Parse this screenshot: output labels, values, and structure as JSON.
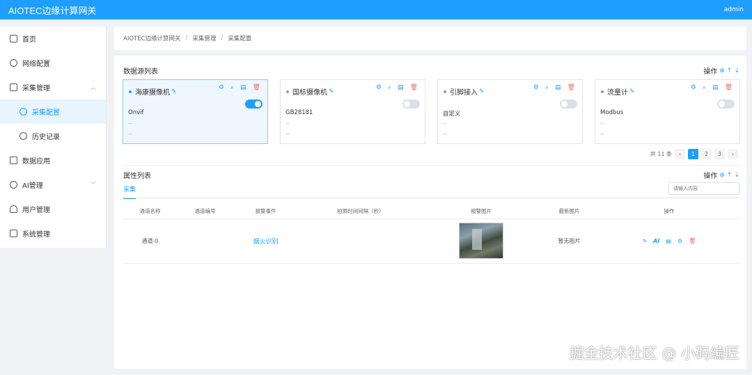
{
  "header": {
    "title": "AIOTEC边缘计算网关",
    "user": "admin"
  },
  "sidebar": {
    "items": [
      {
        "label": "首页",
        "icon": "home-icon"
      },
      {
        "label": "网络配置",
        "icon": "globe-icon"
      },
      {
        "label": "采集管理",
        "icon": "monitor-icon"
      },
      {
        "label": "采集配置",
        "icon": "gear-icon"
      },
      {
        "label": "历史记录",
        "icon": "history-icon"
      },
      {
        "label": "数据应用",
        "icon": "data-icon"
      },
      {
        "label": "AI管理",
        "icon": "ai-icon"
      },
      {
        "label": "用户管理",
        "icon": "user-icon"
      },
      {
        "label": "系统管理",
        "icon": "system-icon"
      }
    ]
  },
  "breadcrumb": [
    "AIOTEC边缘计算网关",
    "采集管理",
    "采集配置"
  ],
  "datasource": {
    "title": "数据源列表",
    "ops_label": "操作",
    "cards": [
      {
        "name": "海康摄像机",
        "protocol": "Onvif",
        "line1": "--",
        "line2": "--",
        "enabled": true
      },
      {
        "name": "国标摄像机",
        "protocol": "GB28181",
        "line1": "--",
        "line2": "--",
        "enabled": false
      },
      {
        "name": "引脚接入",
        "protocol": "自定义",
        "line1": "--",
        "line2": "--",
        "enabled": false
      },
      {
        "name": "流量计",
        "protocol": "Modbus",
        "line1": "--",
        "line2": "--",
        "enabled": false
      }
    ],
    "pager": {
      "total": "共 11 条",
      "prev": "‹",
      "pages": [
        "1",
        "2",
        "3"
      ],
      "next": "›",
      "current": 1
    }
  },
  "attributes": {
    "title": "属性列表",
    "ops_label": "操作",
    "tab": "采集",
    "search_placeholder": "请输入内容",
    "columns": [
      "通道名称",
      "通道编号",
      "报警事件",
      "拍照时间间隔（秒）",
      "报警图片",
      "最新图片",
      "操作"
    ],
    "rows": [
      {
        "name": "通道-0",
        "code": "",
        "event": "烟火识别",
        "interval": "",
        "latest": "暂无图片",
        "ai_label": "AI"
      }
    ]
  },
  "watermark": "掘金技术社区 @ 小码编匠",
  "colors": {
    "primary": "#1e9fff",
    "danger": "#f56c6c"
  }
}
